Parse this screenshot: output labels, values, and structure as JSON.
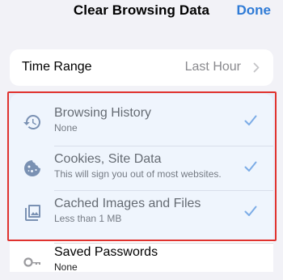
{
  "header": {
    "title": "Clear Browsing Data",
    "done_label": "Done",
    "accent_color": "#2f7bd6"
  },
  "time_range": {
    "label": "Time Range",
    "value": "Last Hour",
    "icon": "chevron-right-icon"
  },
  "data_types": [
    {
      "title": "Browsing History",
      "subtitle": "None",
      "icon": "history-icon",
      "checked": true
    },
    {
      "title": "Cookies, Site Data",
      "subtitle": "This will sign you out of most websites.",
      "icon": "cookie-icon",
      "checked": true
    },
    {
      "title": "Cached Images and Files",
      "subtitle": "Less than 1 MB",
      "icon": "image-icon",
      "checked": true
    },
    {
      "title": "Saved Passwords",
      "subtitle": "None",
      "icon": "key-icon",
      "checked": false
    }
  ],
  "highlight_color": "#e0322e"
}
